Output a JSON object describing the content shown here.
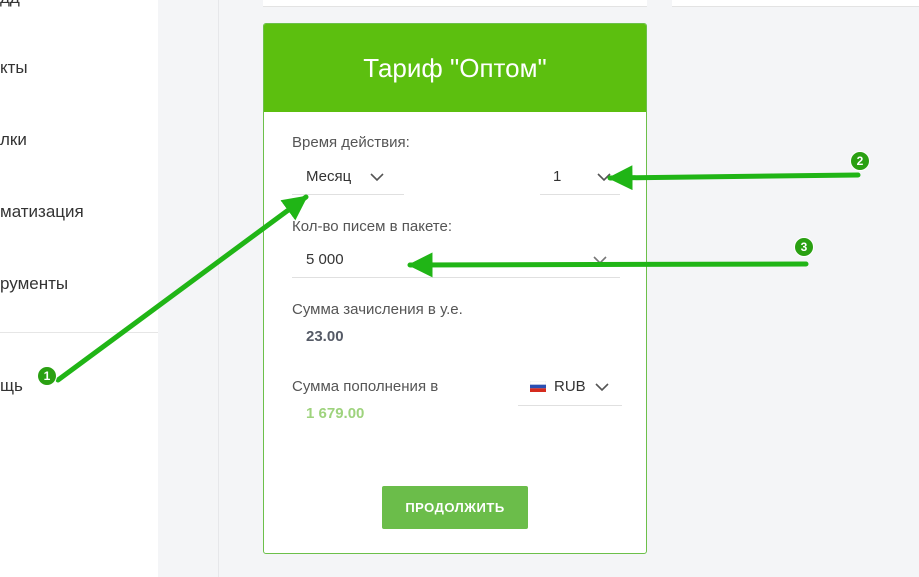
{
  "sidebar": {
    "items": [
      {
        "label": "дд"
      },
      {
        "label": "кты"
      },
      {
        "label": "лки"
      },
      {
        "label": "матизация"
      },
      {
        "label": "рументы"
      },
      {
        "label": "щь"
      }
    ]
  },
  "tariff": {
    "title": "Тариф \"Оптом\"",
    "duration_label": "Время действия:",
    "period_value": "Месяц",
    "count_value": "1",
    "letters_label": "Кол-во писем в пакете:",
    "letters_value": "5 000",
    "credit_label": "Сумма зачисления в у.е.",
    "credit_value": "23.00",
    "topup_label": "Сумма пополнения в",
    "currency_value": "RUB",
    "topup_value": "1 679.00",
    "continue_label": "ПРОДОЛЖИТЬ"
  },
  "annotations": {
    "badge_1": "1",
    "badge_2": "2",
    "badge_3": "3"
  },
  "colors": {
    "brand_green": "#5cbf0f",
    "button_green": "#6bbd4a",
    "topup_value_green": "#9ed37d",
    "arrow_green": "#20b516"
  }
}
